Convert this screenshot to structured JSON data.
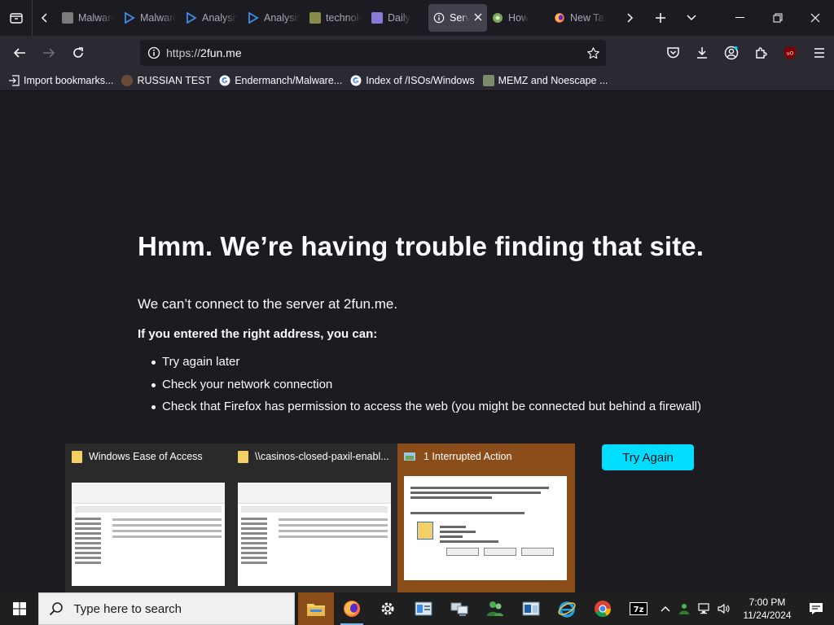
{
  "browser": {
    "tabs": [
      {
        "title": "Malware",
        "favicon": "generic-page",
        "color": "#7b7b7b"
      },
      {
        "title": "Malware",
        "favicon": "analysis-site",
        "color": "#3a8ee6"
      },
      {
        "title": "Analysis",
        "favicon": "analysis-site",
        "color": "#3a8ee6"
      },
      {
        "title": "Analysis",
        "favicon": "analysis-site",
        "color": "#3a8ee6"
      },
      {
        "title": "technology",
        "favicon": "tech-site",
        "color": "#8a8a4a"
      },
      {
        "title": "Daily",
        "favicon": "daily-site",
        "color": "#8a7ad8"
      },
      {
        "title": "Server Not Found",
        "favicon": "info",
        "color": "#fbfbfe",
        "active": true
      },
      {
        "title": "How",
        "favicon": "globe",
        "color": "#7aa85a"
      },
      {
        "title": "New Tab",
        "favicon": "firefox",
        "color": "#ff7139"
      }
    ],
    "url": {
      "scheme": "https://",
      "host": "2fun.me"
    },
    "bookmarks": [
      {
        "label": "Import bookmarks...",
        "icon": "import-icon"
      },
      {
        "label": "RUSSIAN TEST",
        "icon": "user-avatar-icon"
      },
      {
        "label": "Endermanch/Malware...",
        "icon": "google-icon"
      },
      {
        "label": "Index of /ISOs/Windows",
        "icon": "google-icon"
      },
      {
        "label": "MEMZ and Noescape ...",
        "icon": "image-icon"
      }
    ]
  },
  "error_page": {
    "title": "Hmm. We’re having trouble finding that site.",
    "message": "We can’t connect to the server at 2fun.me.",
    "subtitle": "If you entered the right address, you can:",
    "suggestions": [
      "Try again later",
      "Check your network connection",
      "Check that Firefox has permission to access the web (you might be connected but behind a firewall)"
    ],
    "try_again_label": "Try Again"
  },
  "thumbnails": [
    {
      "title": "Windows Ease of Access"
    },
    {
      "title": "\\\\casinos-closed-paxil-enabl..."
    },
    {
      "title": "1 Interrupted Action"
    }
  ],
  "taskbar": {
    "search_placeholder": "Type here to search",
    "time": "7:00 PM",
    "date": "11/24/2024"
  },
  "colors": {
    "accent": "#00ddff",
    "chrome_bg": "#1c1b22",
    "toolbar_bg": "#2b2a33",
    "taskbar_highlight": "#8a4d1a"
  }
}
